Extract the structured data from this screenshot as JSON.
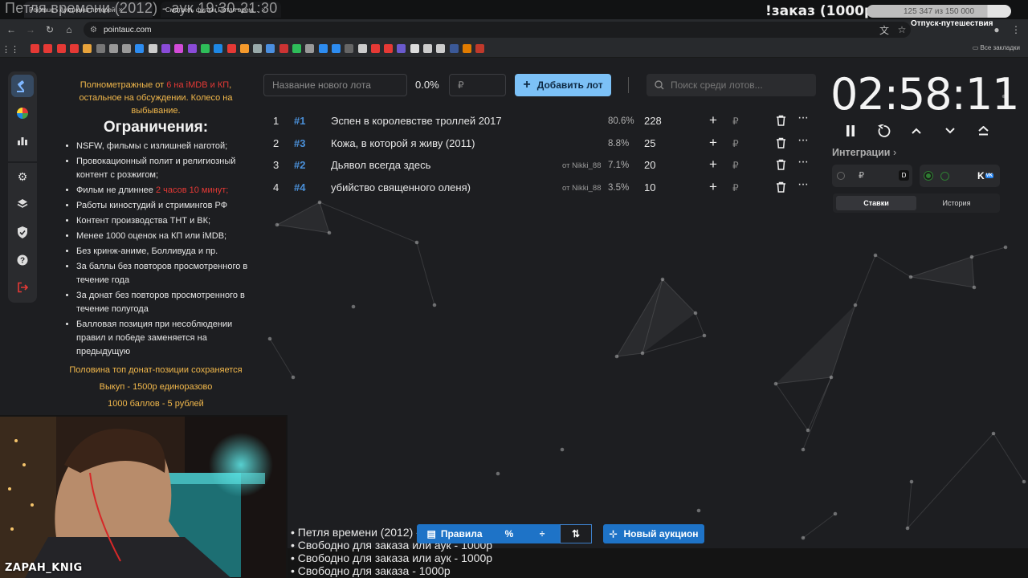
{
  "overlay": {
    "stream_title": "Петля времени (2012) - аук 19:30-21:30",
    "order_label": "!заказ (1000р)",
    "goal_progress": "125 347 из 150 000",
    "goal_fraction": 0.836,
    "trip_label": "Отпуск-путешествия"
  },
  "browser": {
    "tabs": [
      {
        "label": "Pointauc - Аукционы лотерей"
      },
      {
        "label": "Смотреть фильм Петля врем..."
      }
    ],
    "url": "pointauc.com",
    "bookmarks_all": "Все закладки",
    "bookmark_colors": [
      "#e53935",
      "#e53935",
      "#e53935",
      "#e53935",
      "#e8a33b",
      "#777",
      "#999",
      "#999",
      "#2d8cf0",
      "#ccc",
      "#8a4bd8",
      "#d24bd8",
      "#8a4bd8",
      "#2ebd59",
      "#1e88e5",
      "#e53935",
      "#f59a2c",
      "#9aa",
      "#4a8fe0",
      "#cc3333",
      "#2ebd59",
      "#999",
      "#2d8cf0",
      "#2d8cf0",
      "#666",
      "#ccc",
      "#e53935",
      "#e53935",
      "#6a5acd",
      "#ddd",
      "#ccc",
      "#ccc",
      "#3b5998",
      "#e07b00",
      "#c0392b"
    ]
  },
  "sidebar": {
    "icons": [
      "gavel-icon",
      "wheel-icon",
      "stats-icon",
      "settings-icon",
      "layers-icon",
      "shield-icon",
      "help-icon",
      "logout-icon"
    ]
  },
  "rules": {
    "intro_1": "Полнометражные от ",
    "intro_red": "6 на iMDB и КП",
    "intro_2": ", остальное на обсуждении. Колесо на выбывание.",
    "heading": "Ограничения:",
    "items": [
      "NSFW, фильмы с излишней наготой;",
      "Провокационный полит и религиозный контент с розжигом;",
      "Фильм не длиннее ",
      "Работы киностудий и стримингов РФ",
      "Контент производства ТНТ и ВК;",
      "Менее 1000 оценок на КП или iMDB;",
      "Без кринж-аниме, Болливуда и пр.",
      "За баллы без повторов просмотренного в течение года",
      "За донат без повторов просмотренного в течение полугода",
      "Балловая позиция при несоблюдении правил и победе заменяется на предыдущую"
    ],
    "item3_red": "2 часов 10 минут;",
    "footer": [
      "Половина топ донат-позиции сохраняется",
      "Выкуп - 1500р единоразово",
      "1000 баллов - 5 рублей"
    ]
  },
  "toolbar": {
    "lot_name_placeholder": "Название нового лота",
    "percent": "0.0%",
    "amount_placeholder": "₽",
    "add_label": "Добавить лот",
    "search_placeholder": "Поиск среди лотов..."
  },
  "lots": [
    {
      "num": "1",
      "id": "#1",
      "name": "Эспен в королевстве троллей 2017",
      "from": "",
      "percent": "80.6%",
      "amount": "228"
    },
    {
      "num": "2",
      "id": "#3",
      "name": "Кожа, в которой я живу (2011)",
      "from": "",
      "percent": "8.8%",
      "amount": "25"
    },
    {
      "num": "3",
      "id": "#2",
      "name": "Дьявол всегда здесь",
      "from": "от Nikki_88",
      "percent": "7.1%",
      "amount": "20"
    },
    {
      "num": "4",
      "id": "#4",
      "name": "убийство священного оленя)",
      "from": "от Nikki_88",
      "percent": "3.5%",
      "amount": "10"
    }
  ],
  "lot_row_symbols": {
    "plus": "+",
    "rub": "₽",
    "more": "···"
  },
  "timer": {
    "value": "02:58:11"
  },
  "integrations": {
    "title": "Интеграции",
    "card1_currency": "₽",
    "card1_badge": "D",
    "card2_badge": "VK"
  },
  "stakes": {
    "tab_bets": "Ставки",
    "tab_history": "История"
  },
  "bottom": {
    "list": [
      "• Петля времени (2012) - аук",
      "• Свободно для заказа или аук - 1000р",
      "• Свободно для заказа или аук - 1000р",
      "• Свободно для заказа - 1000р"
    ],
    "rules_label": "Правила",
    "percent_symbol": "%",
    "new_auction_label": "Новый аукцион"
  },
  "webcam": {
    "streamer_name": "ZAPAH_KNIG"
  }
}
